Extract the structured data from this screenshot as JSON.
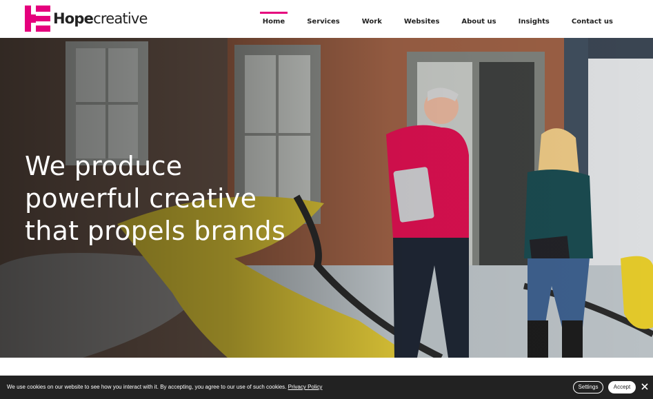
{
  "brand": {
    "name_bold": "Hope",
    "name_light": "creative",
    "accent": "#e5007d"
  },
  "nav": {
    "items": [
      {
        "label": "Home",
        "active": true
      },
      {
        "label": "Services",
        "active": false
      },
      {
        "label": "Work",
        "active": false
      },
      {
        "label": "Websites",
        "active": false
      },
      {
        "label": "About us",
        "active": false
      },
      {
        "label": "Insights",
        "active": false
      },
      {
        "label": "Contact us",
        "active": false
      }
    ]
  },
  "hero": {
    "headline_lines": [
      "We produce",
      "powerful creative",
      "that propels brands"
    ]
  },
  "cookie_bar": {
    "message": "We use cookies on our website to see how you interact with it. By accepting, you agree to our use of such cookies.",
    "link_label": "Privacy Policy",
    "settings_label": "Settings",
    "accept_label": "Accept",
    "close_icon": "close-icon"
  }
}
